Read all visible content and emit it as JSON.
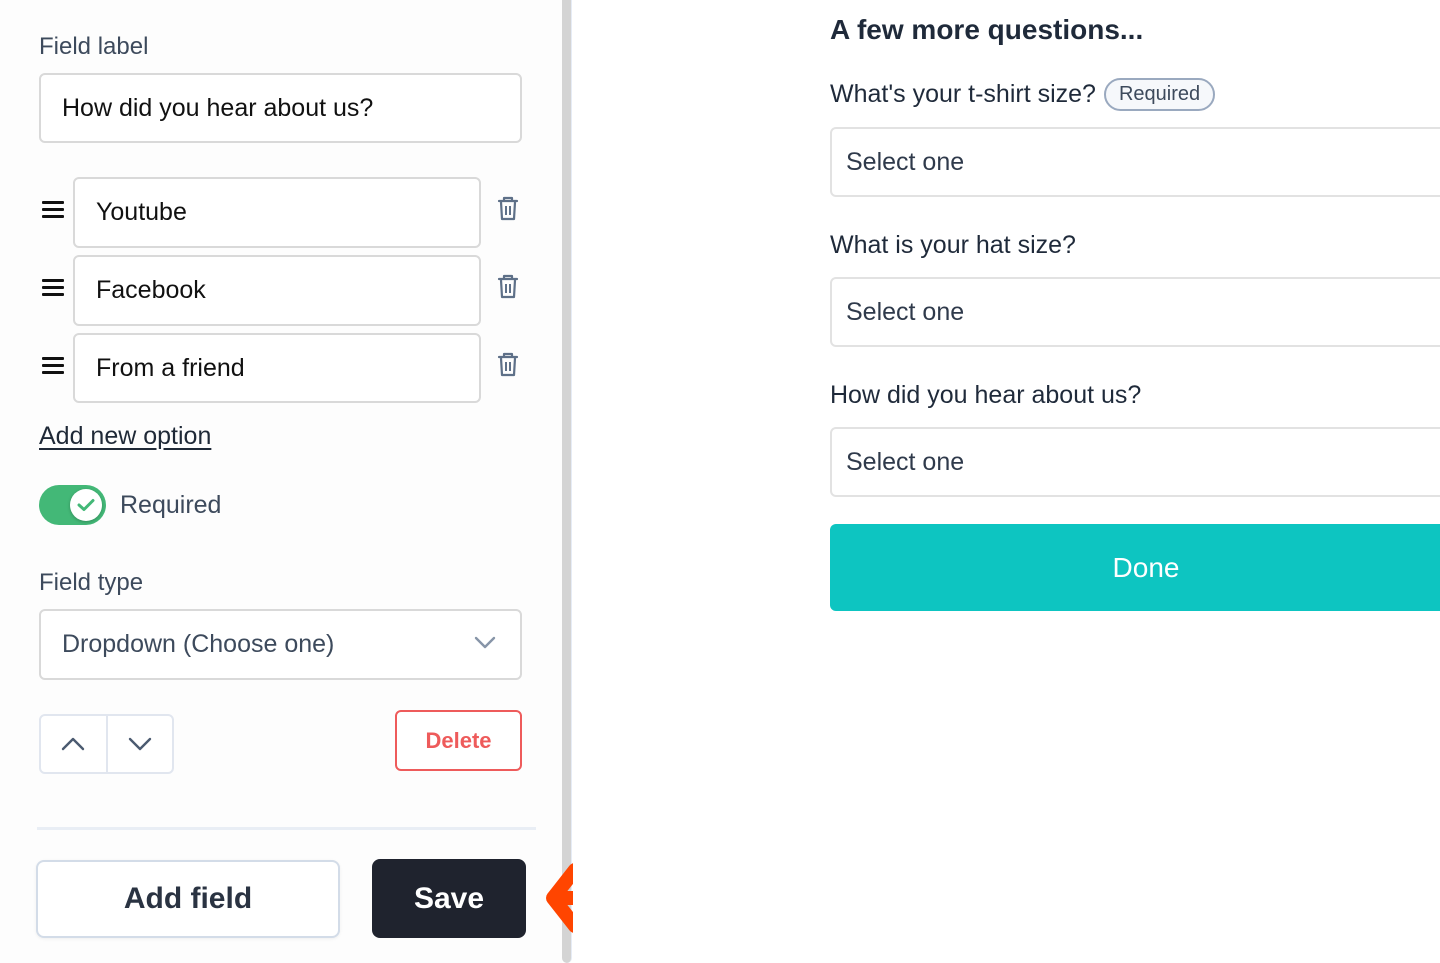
{
  "editor": {
    "field_label_heading": "Field label",
    "field_label_value": "How did you hear about us?",
    "options": [
      {
        "value": "Youtube"
      },
      {
        "value": "Facebook"
      },
      {
        "value": "From a friend"
      }
    ],
    "add_option_link": "Add new option",
    "required_toggle": {
      "label": "Required",
      "on": true
    },
    "field_type_heading": "Field type",
    "field_type_value": "Dropdown (Choose one)",
    "delete_label": "Delete",
    "add_field_label": "Add field",
    "save_label": "Save"
  },
  "preview": {
    "title": "A few more questions...",
    "questions": [
      {
        "label": "What's your t-shirt size?",
        "badge": "Required",
        "placeholder": "Select one"
      },
      {
        "label": "What is your hat size?",
        "placeholder": "Select one"
      },
      {
        "label": "How did you hear about us?",
        "placeholder": "Select one"
      }
    ],
    "done_label": "Done"
  },
  "colors": {
    "toggle_on": "#43b877",
    "delete": "#ee5b5b",
    "save_bg": "#1f232e",
    "done_bg": "#0dc5c1",
    "annotation_arrow": "#ff4500"
  }
}
